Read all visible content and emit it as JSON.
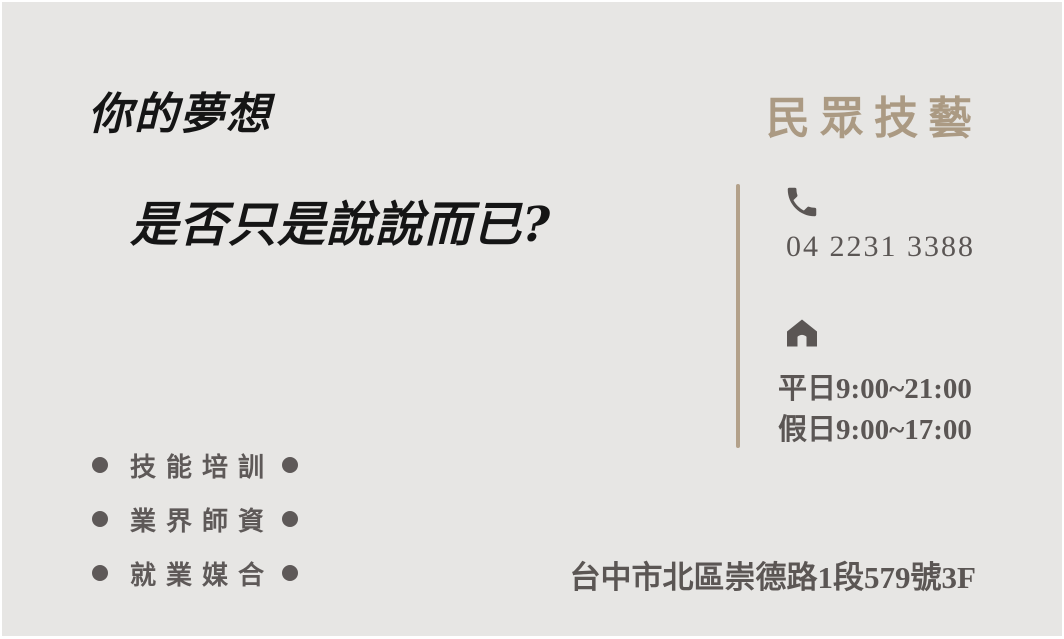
{
  "slogan": {
    "line1": "你的夢想",
    "line2": "是否只是說說而已?"
  },
  "brand": {
    "name": "民眾技藝",
    "color": "#ab9a83"
  },
  "contact": {
    "phone_icon": "phone-icon",
    "phone": "04 2231 3388",
    "home_icon": "home-icon",
    "hours_weekday": "平日9:00~21:00",
    "hours_holiday": "假日9:00~17:00"
  },
  "features": [
    {
      "label": "技能培訓"
    },
    {
      "label": "業界師資"
    },
    {
      "label": "就業媒合"
    }
  ],
  "address": "台中市北區崇德路1段579號3F",
  "colors": {
    "background": "#e7e6e4",
    "text": "#5b5654",
    "divider": "#b3a18a"
  }
}
